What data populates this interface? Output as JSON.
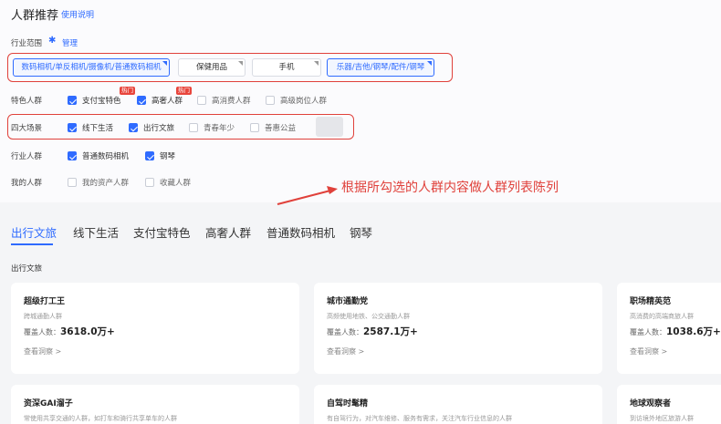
{
  "header": {
    "title": "人群推荐",
    "help_link": "使用说明"
  },
  "industry_scope": {
    "label": "行业范围",
    "manage": "管理",
    "tags": [
      {
        "label": "数码相机/单反相机/摄像机/普通数码相机",
        "selected": true
      },
      {
        "label": "保健用品",
        "selected": false
      },
      {
        "label": "手机",
        "selected": false
      },
      {
        "label": "乐器/吉他/钢琴/配件/钢琴",
        "selected": true
      }
    ]
  },
  "rows": {
    "feature": {
      "label": "特色人群",
      "options": [
        {
          "label": "支付宝特色",
          "checked": true,
          "badge": "热门"
        },
        {
          "label": "高奢人群",
          "checked": true,
          "badge": "热门"
        },
        {
          "label": "高消费人群",
          "checked": false
        },
        {
          "label": "高级岗位人群",
          "checked": false
        }
      ]
    },
    "scenes": {
      "label": "四大场景",
      "options": [
        {
          "label": "线下生活",
          "checked": true
        },
        {
          "label": "出行文旅",
          "checked": true
        },
        {
          "label": "青春年少",
          "checked": false
        },
        {
          "label": "善惠公益",
          "checked": false
        }
      ]
    },
    "industry": {
      "label": "行业人群",
      "options": [
        {
          "label": "普通数码相机",
          "checked": true
        },
        {
          "label": "钢琴",
          "checked": true
        }
      ]
    },
    "mine": {
      "label": "我的人群",
      "options": [
        {
          "label": "我的资产人群",
          "checked": false
        },
        {
          "label": "收藏人群",
          "checked": false
        }
      ]
    }
  },
  "annotation": "根据所勾选的人群内容做人群列表陈列",
  "tabs": [
    "出行文旅",
    "线下生活",
    "支付宝特色",
    "高奢人群",
    "普通数码相机",
    "钢琴"
  ],
  "active_tab": "出行文旅",
  "section_title": "出行文旅",
  "cards": [
    {
      "name": "超级打工王",
      "desc": "跨城通勤人群",
      "coverage_label": "覆盖人数：",
      "coverage_value": "3618.0万+",
      "link": "查看洞察 >"
    },
    {
      "name": "城市通勤党",
      "desc": "高频使用地铁、公交通勤人群",
      "coverage_label": "覆盖人数：",
      "coverage_value": "2587.1万+",
      "link": "查看洞察 >"
    },
    {
      "name": "职场精英范",
      "desc": "高消费的高端商旅人群",
      "coverage_label": "覆盖人数：",
      "coverage_value": "1038.6万+",
      "link": "查看洞察 >"
    },
    {
      "name": "资深GAI溜子",
      "desc": "常使用共享交通的人群，如打车和骑行共享单车的人群"
    },
    {
      "name": "自驾时髦精",
      "desc": "有自驾行为，对汽车维修、服务有需求，关注汽车行业信息的人群"
    },
    {
      "name": "地球观察者",
      "desc": "到访境外地区旅游人群"
    }
  ]
}
